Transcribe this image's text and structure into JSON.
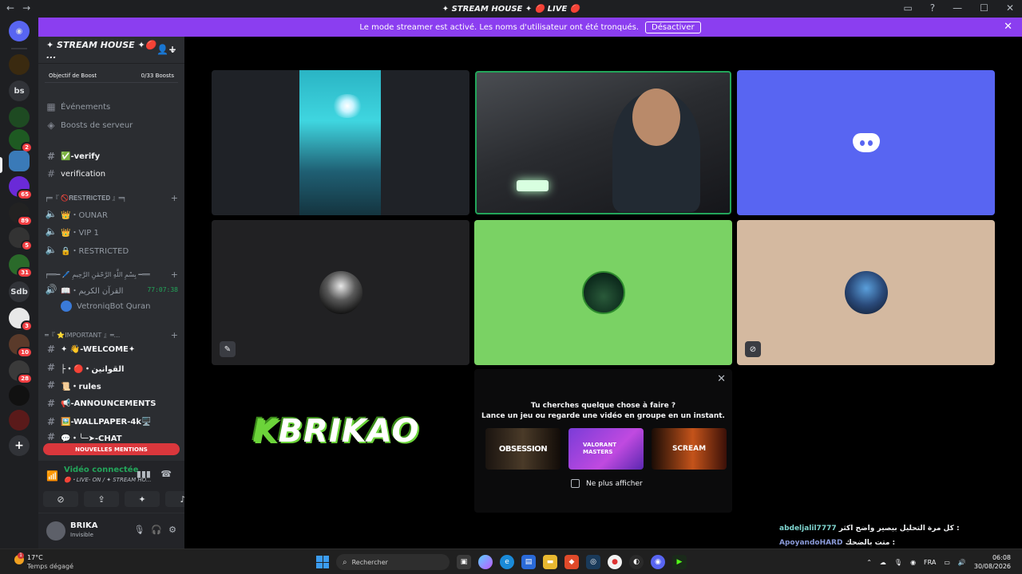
{
  "window": {
    "title": "✦ STREAM HOUSE ✦ 🔴 LIVE 🔴"
  },
  "banner": {
    "text": "Le mode streamer est activé. Les noms d'utilisateur ont été tronqués.",
    "button": "Désactiver"
  },
  "rail": {
    "text_servers": [
      "bs",
      "Sdb"
    ],
    "badges": [
      "2",
      "65",
      "89",
      "5",
      "31",
      "3",
      "10",
      "28"
    ]
  },
  "server": {
    "name": "✦ STREAM HOUSE ✦🔴 ...",
    "boost_label": "Objectif de Boost",
    "boost_count": "0/33 Boosts",
    "events": "Événements",
    "boosts": "Boosts de serveur"
  },
  "channels": {
    "verify": "✅-verify",
    "verification": "verification",
    "cat_restricted": "╒═『 🚫𝐑𝐄𝐒𝐓𝐑𝐈𝐂𝐓𝐄𝐃 』═╕",
    "ounar": "👑・OUNAR",
    "vip": "👑・VIP 1",
    "restricted": "🔒・RESTRICTED",
    "cat_quran": "╒══━ 🖊️ بِسْمِ اللَّهِ الرَّحْمَٰنِ الرَّحِيمِ ━══",
    "quran": "📖・القرآن الكريم",
    "quran_time": "77:07:38",
    "quran_bot": "VetroniqBot Quran",
    "cat_important": "═『 ⭐IMPORTANT 』═...",
    "welcome": "✦ 👋-WELCOME✦",
    "rules_ar": "├・🔴・القوانين",
    "rules": "📜・rules",
    "announcements": "📢-ANNOUNCEMENTS",
    "wallpaper": "🖼️-WALLPAPER-4k🖥️",
    "chat": "💬・╰─➤-CHAT",
    "mentions": "NOUVELLES MENTIONS"
  },
  "voice": {
    "status": "Vidéo connectée",
    "channel": "🔴・LIVE- ON / ✦ STREAM HO..."
  },
  "user": {
    "name": "BRIKA",
    "status": "Invisible"
  },
  "activity": {
    "line1": "Tu cherches quelque chose à faire ?",
    "line2": "Lance un jeu ou regarde une vidéo en groupe en un instant.",
    "games": [
      "OBSESSION",
      "VALORANT MASTERS",
      "SCREAM"
    ],
    "checkbox": "Ne plus afficher"
  },
  "stream_logo": {
    "k": "K",
    "text": "BRIKAO"
  },
  "chat_overlay": [
    {
      "user": "abdeljalil7777",
      "msg": "كل مرة التحليل بيصير واضح اكثر :"
    },
    {
      "user": "ApoyandoHARD",
      "msg": "متت بالضحك :"
    }
  ],
  "taskbar": {
    "weather_temp": "17°C",
    "weather_desc": "Temps dégagé",
    "weather_badge": "1",
    "search": "Rechercher",
    "lang": "FRA",
    "time": "06:08",
    "date": "30/08/2026"
  },
  "colors": {
    "blurple": "#5865f2",
    "banner": "#8b3ef0",
    "green": "#23a55a",
    "mention_red": "#da373c"
  }
}
